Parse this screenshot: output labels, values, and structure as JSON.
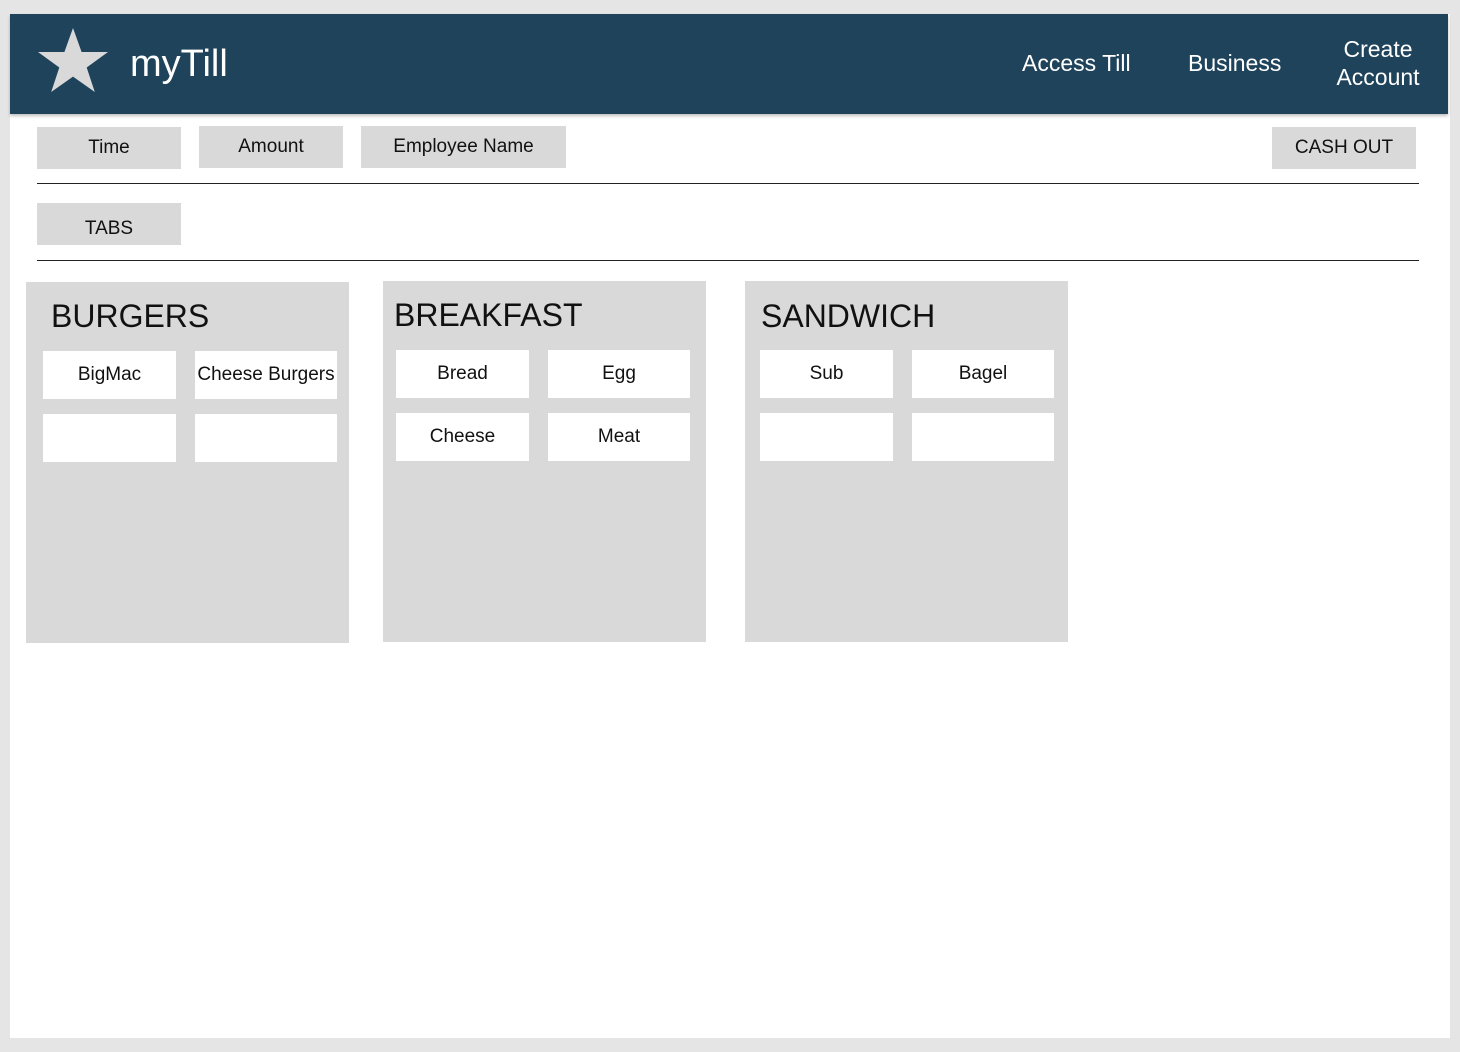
{
  "header": {
    "app_title": "myTill",
    "logo_icon": "star-icon",
    "nav": {
      "access_till": "Access Till",
      "business": "Business",
      "create_account": "Create Account"
    }
  },
  "toolbar": {
    "time": "Time",
    "amount": "Amount",
    "employee_name": "Employee Name",
    "cash_out": "CASH OUT",
    "tabs": "TABS"
  },
  "categories": [
    {
      "title": "BURGERS",
      "items": [
        "BigMac",
        "Cheese Burgers",
        "",
        ""
      ]
    },
    {
      "title": "BREAKFAST",
      "items": [
        "Bread",
        "Egg",
        "Cheese",
        "Meat"
      ]
    },
    {
      "title": "SANDWICH",
      "items": [
        "Sub",
        "Bagel",
        "",
        ""
      ]
    }
  ],
  "colors": {
    "header_bg": "#1e435b",
    "panel_bg": "#d9d9d9",
    "button_bg": "#d9d9d9"
  }
}
